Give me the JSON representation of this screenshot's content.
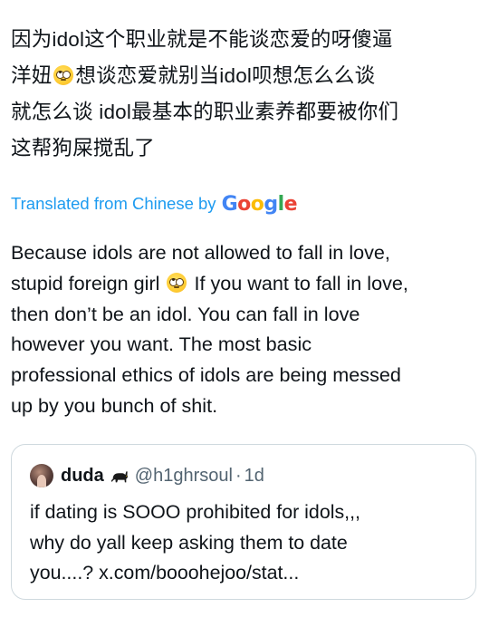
{
  "tweet": {
    "original_line1": "因为idol这个职业就是不能谈恋爱的呀傻逼",
    "original_line2a": "洋妞",
    "original_line2b": "想谈恋爱就别当idol呗想怎么么谈",
    "original_line3": "就怎么谈 idol最基本的职业素养都要被你们",
    "original_line4": "这帮狗屎搅乱了",
    "emoji_name": "face-with-rolling-eyes"
  },
  "translation": {
    "prefix": "Translated from Chinese by",
    "google_logo_text": "Google",
    "brand_colors": [
      "#4285f4",
      "#ea4335",
      "#fbbc05",
      "#4285f4",
      "#34a853",
      "#ea4335"
    ],
    "line1": "Because idols are not allowed to fall in love,",
    "line2a": "stupid foreign girl",
    "line2b": "If you want to fall in love,",
    "line3": "then don’t be an idol. You can fall in love",
    "line4": "however you want. The most basic",
    "line5": "professional ethics of idols are being messed",
    "line6": "up by you bunch of shit.",
    "link_color": "#1d9bf0"
  },
  "quote": {
    "display_name": "duda",
    "handle": "@h1ghrsoul",
    "separator": "·",
    "age": "1d",
    "line1": "if dating is SOOO prohibited for idols,,,",
    "line2": "why do yall keep asking them to date",
    "line3": "you....? x.com/booohejoo/stat..."
  }
}
